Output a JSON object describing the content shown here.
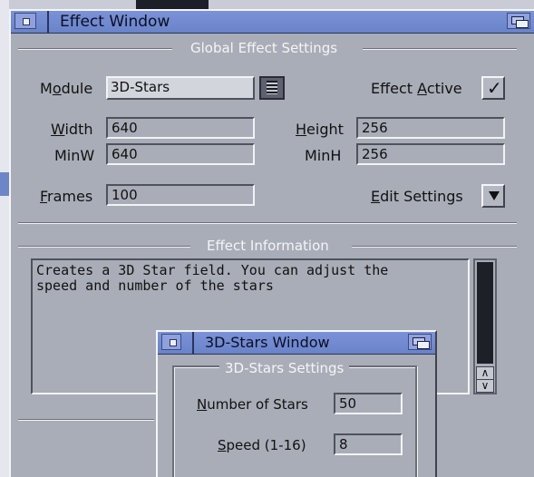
{
  "main_window": {
    "title": "Effect Window",
    "global_section": "Global Effect Settings",
    "module": {
      "label_pre": "M",
      "label_ul": "o",
      "label_post": "dule",
      "value": "3D-Stars"
    },
    "effect_active": {
      "label_pre": "Effect ",
      "label_ul": "A",
      "label_post": "ctive",
      "checked": true,
      "mark": "✓"
    },
    "width": {
      "label_ul": "W",
      "label_post": "idth",
      "value": "640"
    },
    "height": {
      "label_ul": "H",
      "label_post": "eight",
      "value": "256"
    },
    "minw": {
      "label": "MinW",
      "value": "640"
    },
    "minh": {
      "label": "MinH",
      "value": "256"
    },
    "frames": {
      "label_ul": "F",
      "label_post": "rames",
      "value": "100"
    },
    "edit_settings": {
      "label_ul": "E",
      "label_post": "dit Settings"
    },
    "info_section": "Effect Information",
    "info_text": "Creates a 3D Star field. You can adjust the\nspeed and number of the stars",
    "scroll_up": "∧",
    "scroll_down": "∨"
  },
  "sub_window": {
    "title": "3D-Stars Window",
    "settings_section": "3D-Stars Settings",
    "num_stars": {
      "label_ul": "N",
      "label_post": "umber of Stars",
      "value": "50"
    },
    "speed": {
      "label_ul": "S",
      "label_post": "peed (1-16)",
      "value": "8"
    }
  },
  "colors": {
    "titlebar": "#7c92d8",
    "window_bg": "#a9adb7",
    "section_label": "#f4f5f8"
  },
  "icons": {
    "close": "close-gadget-icon",
    "depth": "depth-gadget-icon",
    "popup": "popup-list-icon",
    "dropdown": "triangle-down-icon",
    "check": "checkmark-icon"
  }
}
